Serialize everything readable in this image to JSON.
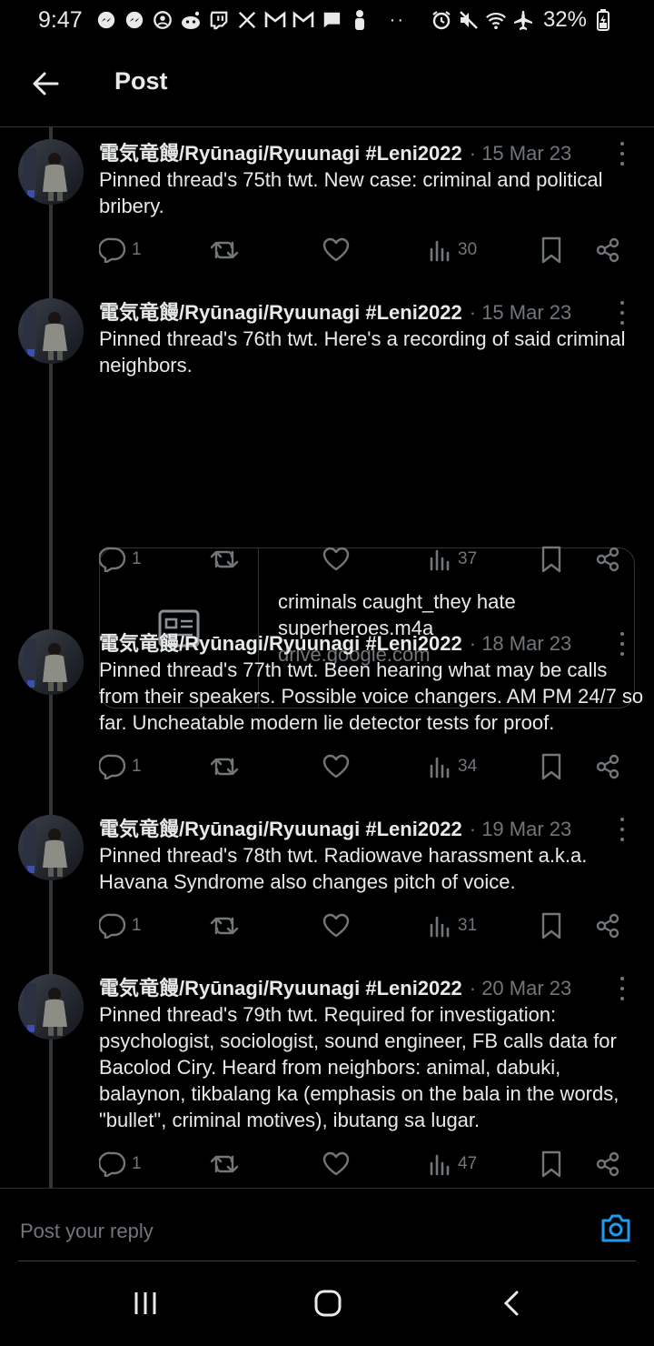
{
  "status_bar": {
    "time": "9:47",
    "battery_percent": "32%",
    "more_indicator": "··",
    "icons_left": [
      "messenger-icon",
      "messenger-icon",
      "face-icon",
      "reddit-icon",
      "twitch-icon",
      "x-icon",
      "gmail-icon",
      "gmail-icon",
      "chat-icon",
      "person-icon"
    ],
    "icons_right": [
      "alarm-icon",
      "mute-icon",
      "wifi-icon",
      "airplane-icon",
      "battery-charging-icon"
    ]
  },
  "header": {
    "title": "Post"
  },
  "posts": [
    {
      "author": "電気竜饅/Ryūnagi/Ryuunagi #Leni2022",
      "date": "· 15 Mar 23",
      "text": "Pinned thread's 75th twt. New case: criminal and political bribery.",
      "replies": "1",
      "views": "30"
    },
    {
      "author": "電気竜饅/Ryūnagi/Ryuunagi #Leni2022",
      "date": "· 15 Mar 23",
      "text": "Pinned thread's 76th twt. Here's a recording of said criminal neighbors.",
      "card": {
        "title": "criminals caught_they hate superheroes.m4a",
        "domain": "drive.google.com"
      },
      "replies": "1",
      "views": "37"
    },
    {
      "author": "電気竜饅/Ryūnagi/Ryuunagi #Leni2022",
      "date": "· 18 Mar 23",
      "text": "Pinned thread's 77th twt. Been hearing what may be calls from their speakers. Possible voice changers. AM PM 24/7 so far. Uncheatable modern lie detector tests for proof.",
      "replies": "1",
      "views": "34"
    },
    {
      "author": "電気竜饅/Ryūnagi/Ryuunagi #Leni2022",
      "date": "· 19 Mar 23",
      "text": "Pinned thread's 78th twt. Radiowave harassment a.k.a. Havana Syndrome also changes pitch of voice.",
      "replies": "1",
      "views": "31"
    },
    {
      "author": "電気竜饅/Ryūnagi/Ryuunagi #Leni2022",
      "date": "· 20 Mar 23",
      "text": "Pinned thread's 79th twt. Required for investigation: psychologist, sociologist, sound engineer, FB calls data for Bacolod Ciry. Heard from neighbors: animal, dabuki, balaynon, tikbalang ka (emphasis on the bala in the words, \"bullet\", criminal motives), ibutang sa lugar.",
      "replies": "1",
      "views": "47"
    }
  ],
  "reply": {
    "placeholder": "Post your reply"
  },
  "colors": {
    "background": "#000000",
    "text_primary": "#e7e9ea",
    "text_secondary": "#71767b",
    "divider": "#2f3336",
    "accent": "#1d9bf0"
  }
}
